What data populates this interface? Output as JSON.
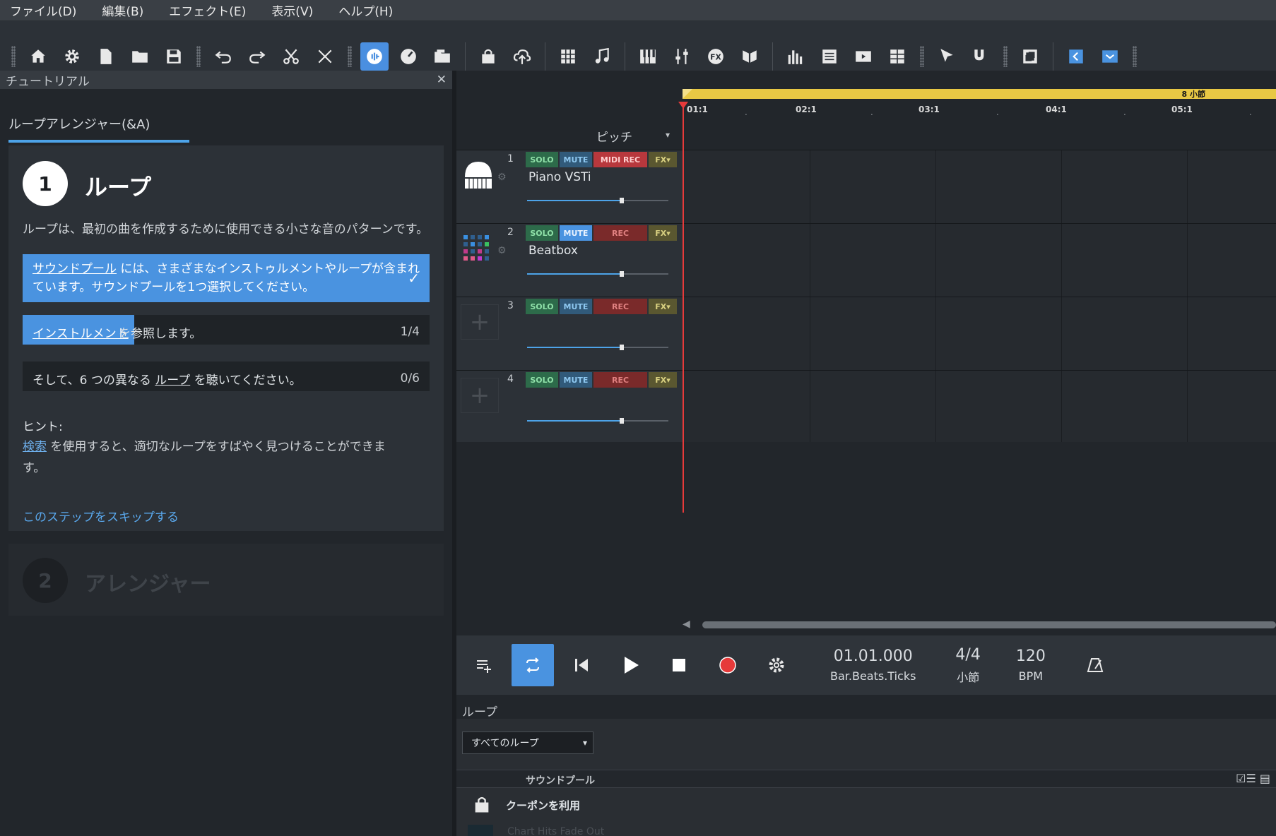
{
  "menu": [
    "ファイル(D)",
    "編集(B)",
    "エフェクト(E)",
    "表示(V)",
    "ヘルプ(H)"
  ],
  "tutorial": {
    "panel_title": "チュートリアル",
    "tab_label": "ループアレンジャー(&A)",
    "step1": {
      "number": "1",
      "title": "ループ",
      "description": "ループは、最初の曲を作成するために使用できる小さな音のパターンです。",
      "task1_link": "サウンドプール",
      "task1_rest_line1": " には、さまざまなインストゥルメントやループが含まれ",
      "task1_rest_line2": "ています。サウンドプールを1つ選択してください。",
      "task2_link": "インストルメント",
      "task2_rest": "を参照します。",
      "task2_count": "1/4",
      "task3_pre": "そして、6 つの異なる ",
      "task3_link": "ループ",
      "task3_post": " を聴いてください。",
      "task3_count": "0/6",
      "hint_label": "ヒント:",
      "hint_link": "検索",
      "hint_rest": " を使用すると、適切なループをすばやく見つけることができま",
      "hint_rest2": "す。",
      "skip": "このステップをスキップする"
    },
    "step2": {
      "number": "2",
      "title": "アレンジャー"
    }
  },
  "arranger": {
    "loop_range_label": "8 小節",
    "ruler": [
      "01:1",
      "02:1",
      "03:1",
      "04:1",
      "05:1"
    ],
    "pitch_label": "ピッチ",
    "tracks": [
      {
        "num": "1",
        "name": "Piano VSTi",
        "solo": "SOLO",
        "mute": "MUTE",
        "rec": "MIDI REC",
        "fx": "FX▾",
        "volume": 0.67
      },
      {
        "num": "2",
        "name": "Beatbox",
        "solo": "SOLO",
        "mute": "MUTE",
        "rec": "REC",
        "fx": "FX▾",
        "volume": 0.67
      },
      {
        "num": "3",
        "name": "",
        "solo": "SOLO",
        "mute": "MUTE",
        "rec": "REC",
        "fx": "FX▾",
        "volume": 0.67
      },
      {
        "num": "4",
        "name": "",
        "solo": "SOLO",
        "mute": "MUTE",
        "rec": "REC",
        "fx": "FX▾",
        "volume": 0.67
      }
    ]
  },
  "transport": {
    "position": "01.01.000",
    "position_unit": "Bar.Beats.Ticks",
    "time_sig": "4/4",
    "time_sig_unit": "小節",
    "tempo": "120",
    "tempo_unit": "BPM"
  },
  "loops": {
    "label": "ループ",
    "filter": "すべてのループ",
    "column": "サウンドプール",
    "row1": "クーポンを利用",
    "row2": "Chart Hits Fade Out"
  },
  "colors": {
    "accent": "#4a93e0",
    "playhead": "#e63a3a",
    "loop_bar": "#e8c844"
  }
}
